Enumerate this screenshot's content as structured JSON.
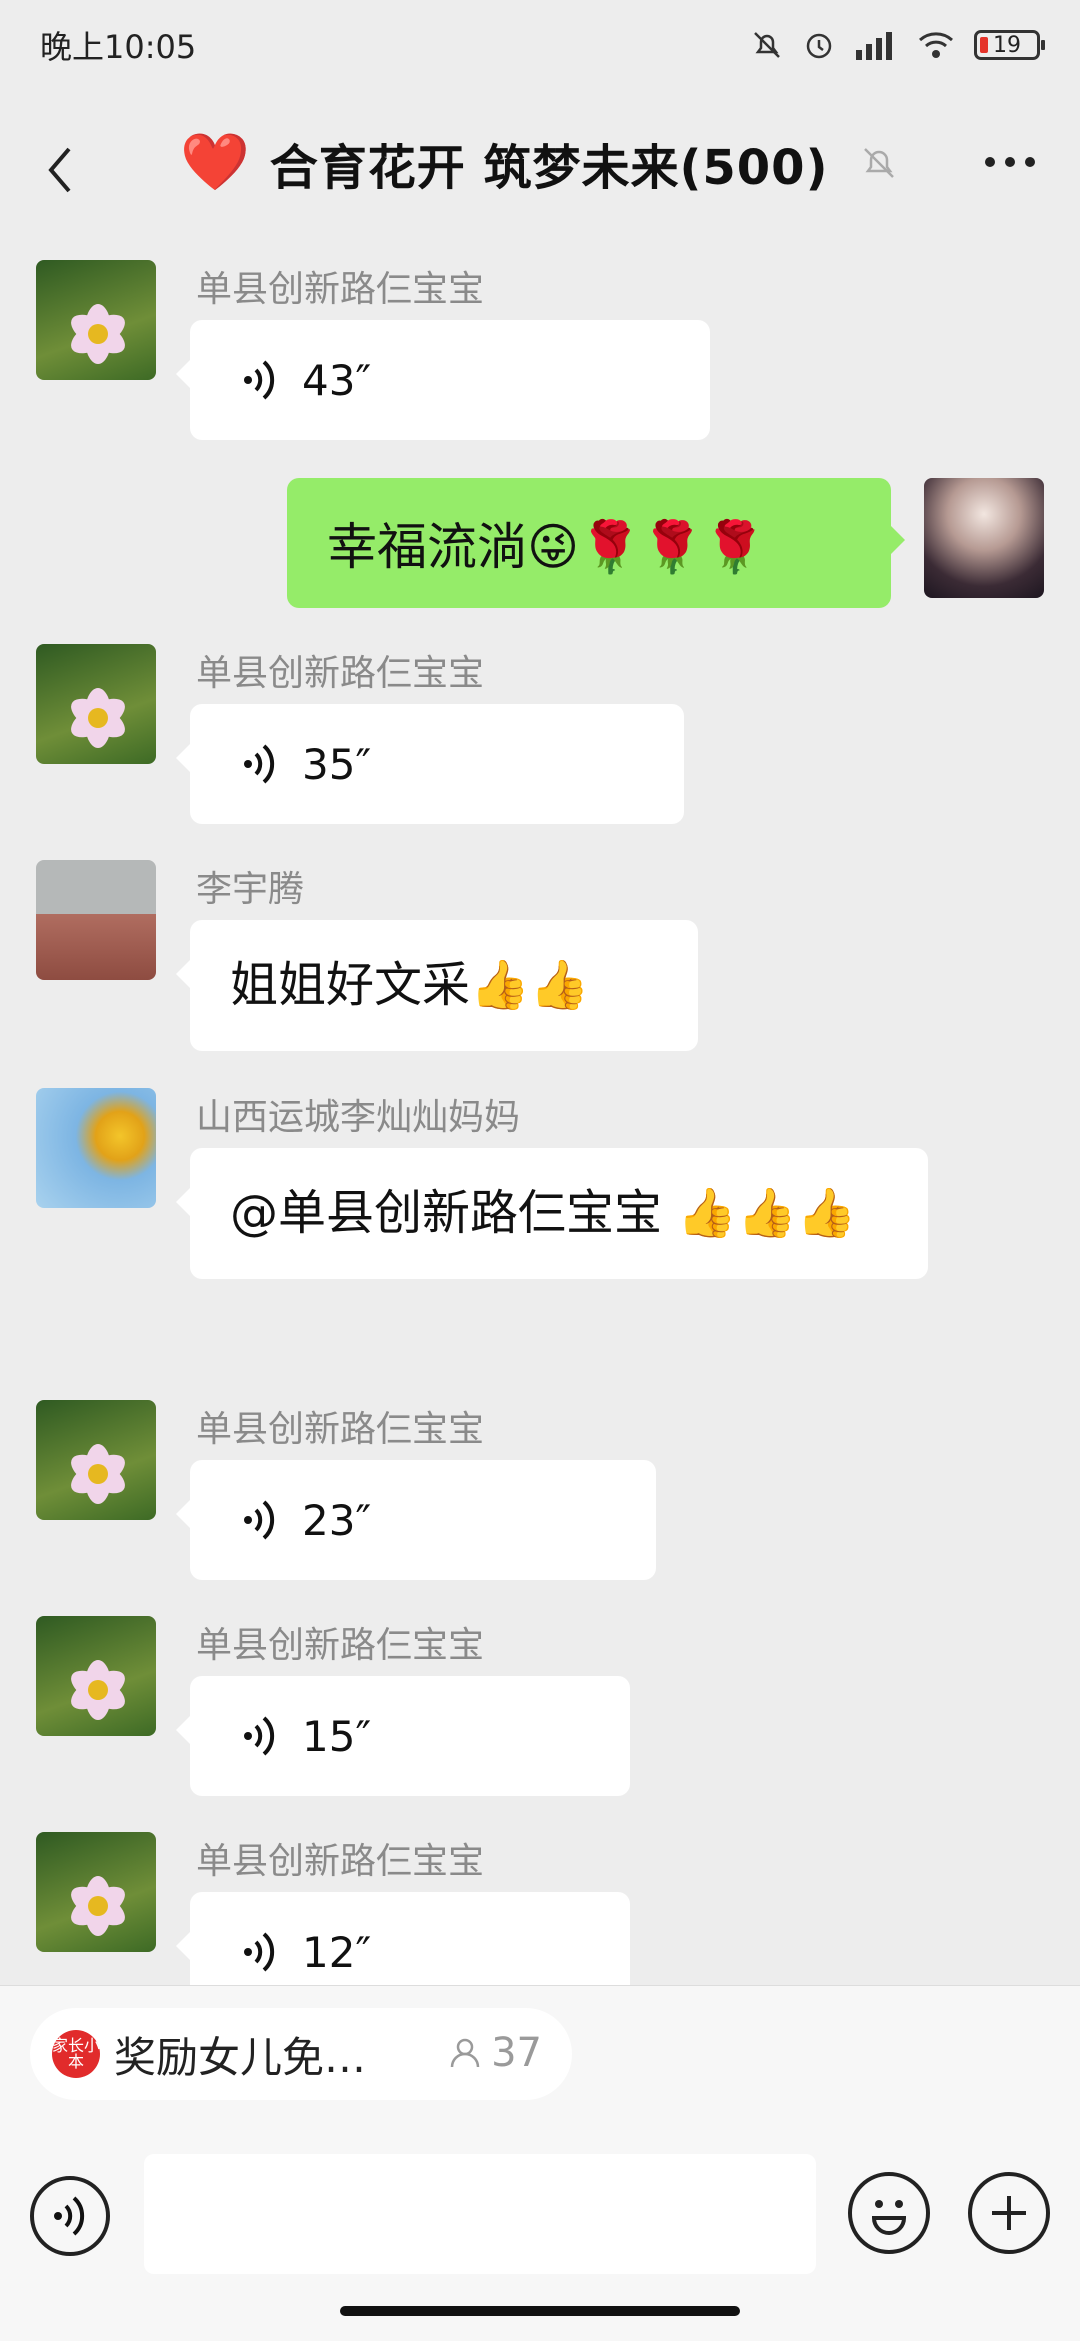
{
  "status": {
    "time": "晚上10:05",
    "battery": "19"
  },
  "header": {
    "title": "合育花开 筑梦未来(500)",
    "heart": "❤️"
  },
  "messages": [
    {
      "sender": "单县创新路仨宝宝",
      "duration": "43″"
    },
    {
      "me_text": "幸福流淌😜🌹🌹🌹"
    },
    {
      "sender": "单县创新路仨宝宝",
      "duration": "35″"
    },
    {
      "sender": "李宇腾",
      "text": "姐姐好文采👍👍"
    },
    {
      "sender": "山西运城李灿灿妈妈",
      "text": "@单县创新路仨宝宝 👍👍👍"
    },
    {
      "sender": "单县创新路仨宝宝",
      "duration": "23″"
    },
    {
      "sender": "单县创新路仨宝宝",
      "duration": "15″"
    },
    {
      "sender": "单县创新路仨宝宝",
      "duration": "12″"
    }
  ],
  "bottom": {
    "pill_logo": "家长小本",
    "pill_text": "奖励女儿免…",
    "pill_count": "37"
  },
  "icons": {
    "back": "chevron-left-icon",
    "mute": "bell-off-icon",
    "more": "more-dots-icon",
    "voice": "voice-icon",
    "emoji": "smile-icon",
    "plus": "plus-icon"
  }
}
